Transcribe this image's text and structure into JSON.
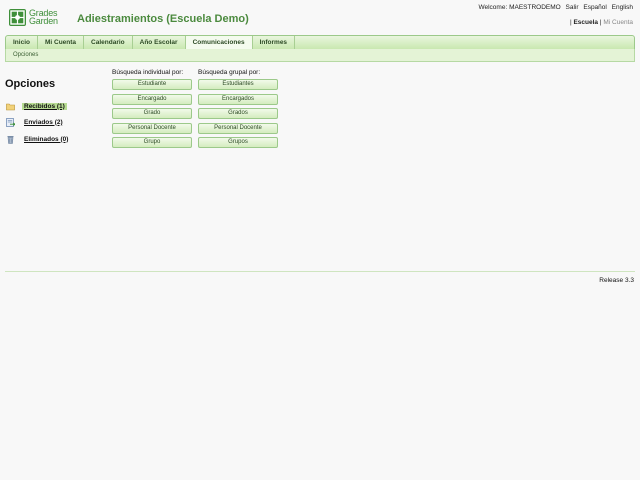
{
  "logo": {
    "line1": "Grades",
    "line2": "Garden"
  },
  "app_title": "Adiestramientos (Escuela Demo)",
  "top_links": {
    "welcome": "Welcome: MAESTRODEMO",
    "logout": "Salir",
    "lang_es": "Español",
    "lang_en": "English"
  },
  "school_links": {
    "active": "Escuela",
    "separator": "|",
    "inactive": "Mi Cuenta"
  },
  "nav": {
    "tabs": [
      {
        "label": "Inicio"
      },
      {
        "label": "Mi Cuenta"
      },
      {
        "label": "Calendario"
      },
      {
        "label": "Año Escolar"
      },
      {
        "label": "Comunicaciones",
        "active": true
      },
      {
        "label": "Informes"
      }
    ],
    "sub_label": "Opciones"
  },
  "sidebar": {
    "title": "Opciones",
    "folders": [
      {
        "label": "Recibidos (1)",
        "icon": "folder-icon",
        "selected": true
      },
      {
        "label": "Enviados (2)",
        "icon": "sent-mail-icon"
      },
      {
        "label": "Eliminados (0)",
        "icon": "trash-icon"
      }
    ]
  },
  "individual_search": {
    "header": "Búsqueda individual por:",
    "buttons": [
      "Estudiante",
      "Encargado",
      "Grado",
      "Personal Docente",
      "Grupo"
    ]
  },
  "group_search": {
    "header": "Búsqueda grupal por:",
    "buttons": [
      "Estudiantes",
      "Encargados",
      "Grados",
      "Personal Docente",
      "Grupos"
    ]
  },
  "footer": {
    "release": "Release 3.3"
  },
  "colors": {
    "brand_green": "#3f8f3a",
    "nav_bg": "#c9e8b0",
    "selected_bg": "#b7dc92"
  }
}
